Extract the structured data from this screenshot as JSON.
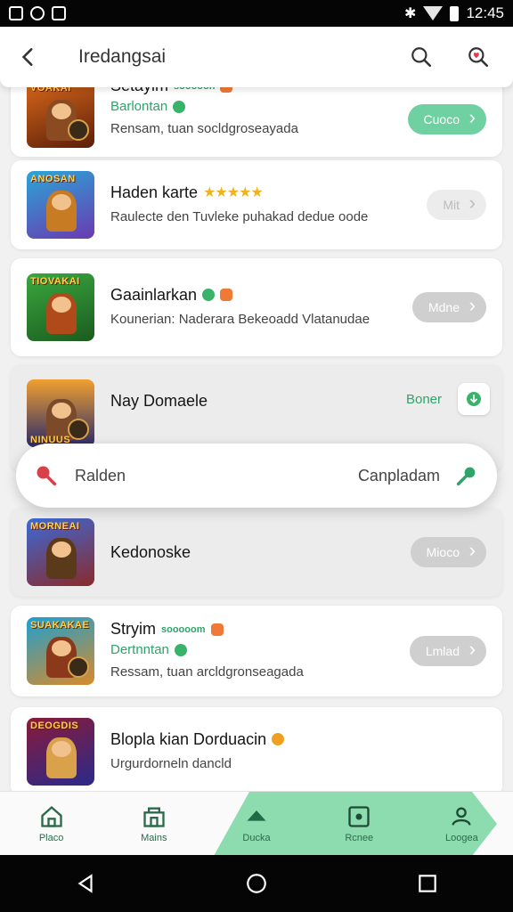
{
  "status": {
    "time": "12:45"
  },
  "header": {
    "title": "Iredangsai"
  },
  "cards": [
    {
      "name": "Setayim",
      "tag": "sooooon",
      "sub": "Barlontan",
      "desc": "Rensam, tuan socldgroseayada",
      "button": "Cuoco",
      "logo": "VOAKAI",
      "colors": [
        "#d9681c",
        "#5b1e08"
      ]
    },
    {
      "name": "Haden karte",
      "stars": "★★★★★",
      "sub": "",
      "desc": "Raulecte den Tuvleke puhakad dedue oode",
      "button": "Mit",
      "logo": "ANOSAN",
      "colors": [
        "#2aa6d8",
        "#6a3ab0"
      ]
    },
    {
      "name": "Gaainlarkan",
      "sub": "",
      "desc": "Kounerian: Naderara Bekeoadd Vlatanudae",
      "button": "Mdne",
      "logo": "TIOVAKAI",
      "colors": [
        "#3aa840",
        "#1b5b1e"
      ]
    },
    {
      "name": "Nay Domaele",
      "sideLabel": "Boner",
      "logo": "NINUUS",
      "colors": [
        "#f0a030",
        "#2a2a6a"
      ]
    },
    {
      "name": "Kedonoske",
      "button": "Mioco",
      "logo": "MORNEAI",
      "colors": [
        "#3a6ad8",
        "#8a2a2a"
      ]
    },
    {
      "name": "Stryim",
      "tag": "sooooom",
      "sub": "Dertnntan",
      "desc": "Ressam, tuan arcldgronseagada",
      "button": "Lmlad",
      "logo": "SUAKAKAE",
      "colors": [
        "#1ea0d0",
        "#d88a2a"
      ]
    },
    {
      "name": "Blopla kian Dorduacin",
      "desc": "Urgurdorneln dancld",
      "logo": "DEOGDIS",
      "colors": [
        "#8a1a3a",
        "#2a2a8a"
      ]
    }
  ],
  "floatbar": {
    "left": "Ralden",
    "right": "Canpladam"
  },
  "nav": [
    {
      "label": "Placo",
      "icon": "home-icon"
    },
    {
      "label": "Mains",
      "icon": "store-icon"
    },
    {
      "label": "Ducka",
      "icon": "ship-icon"
    },
    {
      "label": "Rcnee",
      "icon": "camera-icon"
    },
    {
      "label": "Loogea",
      "icon": "profile-icon"
    }
  ]
}
